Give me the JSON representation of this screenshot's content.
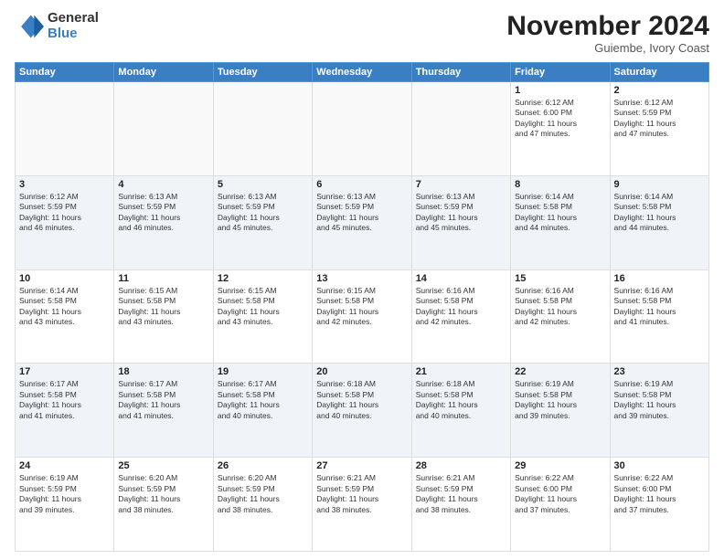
{
  "logo": {
    "general": "General",
    "blue": "Blue"
  },
  "title": "November 2024",
  "location": "Guiembe, Ivory Coast",
  "days_of_week": [
    "Sunday",
    "Monday",
    "Tuesday",
    "Wednesday",
    "Thursday",
    "Friday",
    "Saturday"
  ],
  "weeks": [
    [
      {
        "day": "",
        "info": ""
      },
      {
        "day": "",
        "info": ""
      },
      {
        "day": "",
        "info": ""
      },
      {
        "day": "",
        "info": ""
      },
      {
        "day": "",
        "info": ""
      },
      {
        "day": "1",
        "info": "Sunrise: 6:12 AM\nSunset: 6:00 PM\nDaylight: 11 hours\nand 47 minutes."
      },
      {
        "day": "2",
        "info": "Sunrise: 6:12 AM\nSunset: 5:59 PM\nDaylight: 11 hours\nand 47 minutes."
      }
    ],
    [
      {
        "day": "3",
        "info": "Sunrise: 6:12 AM\nSunset: 5:59 PM\nDaylight: 11 hours\nand 46 minutes."
      },
      {
        "day": "4",
        "info": "Sunrise: 6:13 AM\nSunset: 5:59 PM\nDaylight: 11 hours\nand 46 minutes."
      },
      {
        "day": "5",
        "info": "Sunrise: 6:13 AM\nSunset: 5:59 PM\nDaylight: 11 hours\nand 45 minutes."
      },
      {
        "day": "6",
        "info": "Sunrise: 6:13 AM\nSunset: 5:59 PM\nDaylight: 11 hours\nand 45 minutes."
      },
      {
        "day": "7",
        "info": "Sunrise: 6:13 AM\nSunset: 5:59 PM\nDaylight: 11 hours\nand 45 minutes."
      },
      {
        "day": "8",
        "info": "Sunrise: 6:14 AM\nSunset: 5:58 PM\nDaylight: 11 hours\nand 44 minutes."
      },
      {
        "day": "9",
        "info": "Sunrise: 6:14 AM\nSunset: 5:58 PM\nDaylight: 11 hours\nand 44 minutes."
      }
    ],
    [
      {
        "day": "10",
        "info": "Sunrise: 6:14 AM\nSunset: 5:58 PM\nDaylight: 11 hours\nand 43 minutes."
      },
      {
        "day": "11",
        "info": "Sunrise: 6:15 AM\nSunset: 5:58 PM\nDaylight: 11 hours\nand 43 minutes."
      },
      {
        "day": "12",
        "info": "Sunrise: 6:15 AM\nSunset: 5:58 PM\nDaylight: 11 hours\nand 43 minutes."
      },
      {
        "day": "13",
        "info": "Sunrise: 6:15 AM\nSunset: 5:58 PM\nDaylight: 11 hours\nand 42 minutes."
      },
      {
        "day": "14",
        "info": "Sunrise: 6:16 AM\nSunset: 5:58 PM\nDaylight: 11 hours\nand 42 minutes."
      },
      {
        "day": "15",
        "info": "Sunrise: 6:16 AM\nSunset: 5:58 PM\nDaylight: 11 hours\nand 42 minutes."
      },
      {
        "day": "16",
        "info": "Sunrise: 6:16 AM\nSunset: 5:58 PM\nDaylight: 11 hours\nand 41 minutes."
      }
    ],
    [
      {
        "day": "17",
        "info": "Sunrise: 6:17 AM\nSunset: 5:58 PM\nDaylight: 11 hours\nand 41 minutes."
      },
      {
        "day": "18",
        "info": "Sunrise: 6:17 AM\nSunset: 5:58 PM\nDaylight: 11 hours\nand 41 minutes."
      },
      {
        "day": "19",
        "info": "Sunrise: 6:17 AM\nSunset: 5:58 PM\nDaylight: 11 hours\nand 40 minutes."
      },
      {
        "day": "20",
        "info": "Sunrise: 6:18 AM\nSunset: 5:58 PM\nDaylight: 11 hours\nand 40 minutes."
      },
      {
        "day": "21",
        "info": "Sunrise: 6:18 AM\nSunset: 5:58 PM\nDaylight: 11 hours\nand 40 minutes."
      },
      {
        "day": "22",
        "info": "Sunrise: 6:19 AM\nSunset: 5:58 PM\nDaylight: 11 hours\nand 39 minutes."
      },
      {
        "day": "23",
        "info": "Sunrise: 6:19 AM\nSunset: 5:58 PM\nDaylight: 11 hours\nand 39 minutes."
      }
    ],
    [
      {
        "day": "24",
        "info": "Sunrise: 6:19 AM\nSunset: 5:59 PM\nDaylight: 11 hours\nand 39 minutes."
      },
      {
        "day": "25",
        "info": "Sunrise: 6:20 AM\nSunset: 5:59 PM\nDaylight: 11 hours\nand 38 minutes."
      },
      {
        "day": "26",
        "info": "Sunrise: 6:20 AM\nSunset: 5:59 PM\nDaylight: 11 hours\nand 38 minutes."
      },
      {
        "day": "27",
        "info": "Sunrise: 6:21 AM\nSunset: 5:59 PM\nDaylight: 11 hours\nand 38 minutes."
      },
      {
        "day": "28",
        "info": "Sunrise: 6:21 AM\nSunset: 5:59 PM\nDaylight: 11 hours\nand 38 minutes."
      },
      {
        "day": "29",
        "info": "Sunrise: 6:22 AM\nSunset: 6:00 PM\nDaylight: 11 hours\nand 37 minutes."
      },
      {
        "day": "30",
        "info": "Sunrise: 6:22 AM\nSunset: 6:00 PM\nDaylight: 11 hours\nand 37 minutes."
      }
    ]
  ]
}
